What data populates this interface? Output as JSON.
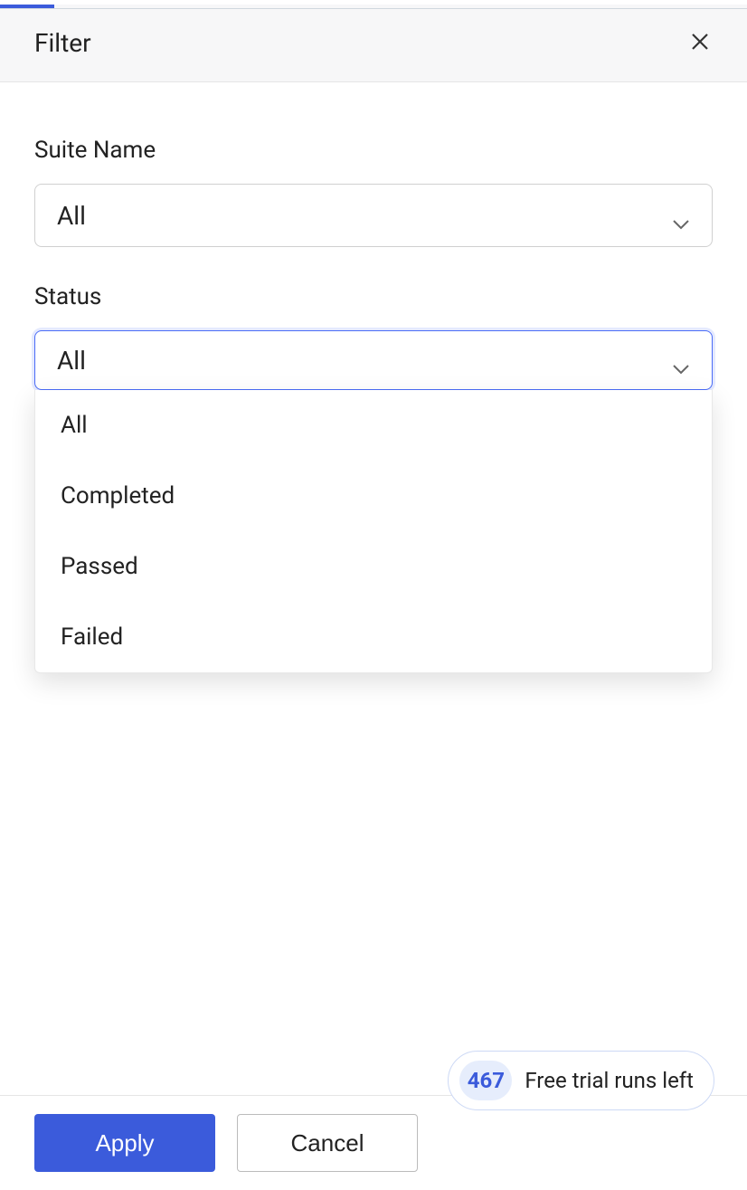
{
  "header": {
    "title": "Filter"
  },
  "fields": {
    "suite_name": {
      "label": "Suite Name",
      "selected": "All"
    },
    "status": {
      "label": "Status",
      "selected": "All",
      "options": [
        "All",
        "Completed",
        "Passed",
        "Failed"
      ]
    }
  },
  "footer": {
    "apply_label": "Apply",
    "cancel_label": "Cancel"
  },
  "trial": {
    "count": "467",
    "text": "Free trial runs left"
  }
}
